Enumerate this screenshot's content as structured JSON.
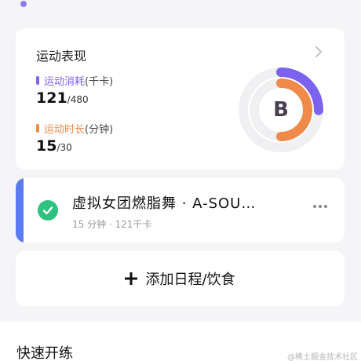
{
  "performance": {
    "title": "运动表现",
    "calories": {
      "label": "运动消耗",
      "unit": "(千卡)",
      "value": "121",
      "target": "/480",
      "color": "#7b63f0"
    },
    "duration": {
      "label": "运动时长",
      "unit": "(分钟)",
      "value": "15",
      "target": "/30",
      "color": "#f08a4b"
    },
    "grade": "B"
  },
  "schedule_item": {
    "title": "虚拟女团燃脂舞 · A-SOU…",
    "meta": "15 分钟 · 121千卡",
    "status": "completed",
    "accent_color": "#5b7cf0",
    "check_color": "#2ec27e"
  },
  "add_button": {
    "label": "添加日程/饮食"
  },
  "quick_start": {
    "title": "快速开练"
  },
  "watermark": "@稀土掘金技术社区"
}
